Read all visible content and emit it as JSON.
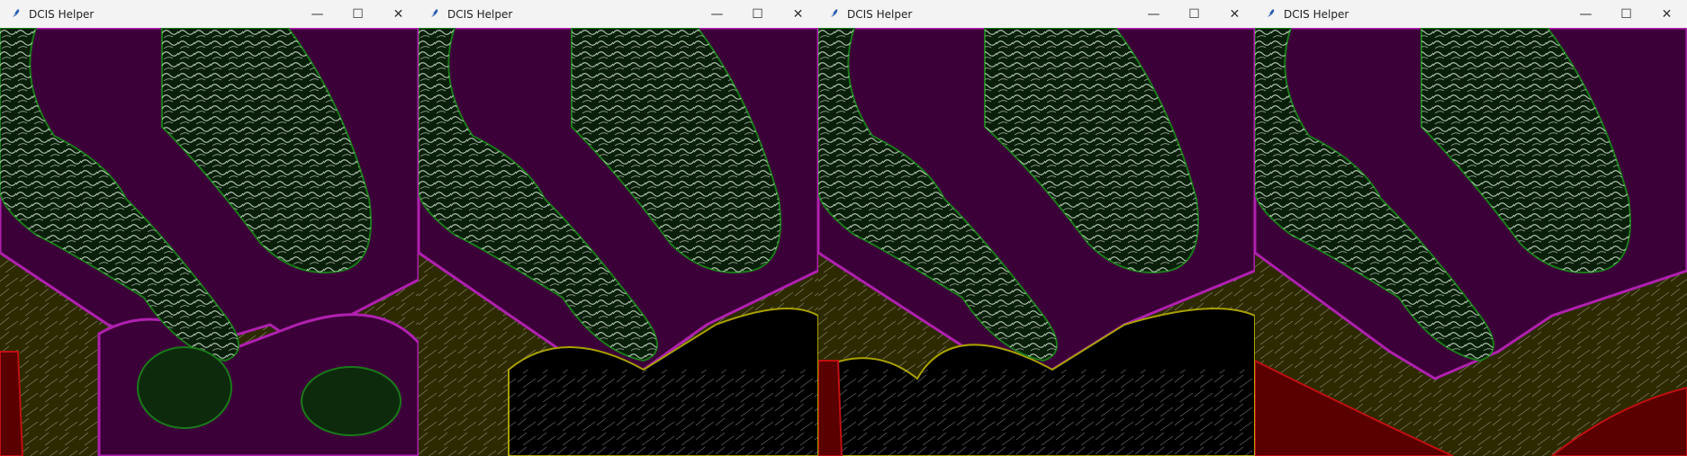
{
  "windows": [
    {
      "title": "DCIS Helper",
      "variant": 1
    },
    {
      "title": "DCIS Helper",
      "variant": 2
    },
    {
      "title": "DCIS Helper",
      "variant": 3
    },
    {
      "title": "DCIS Helper",
      "variant": 4
    }
  ],
  "controls": {
    "minimize": "—",
    "maximize": "☐",
    "close": "✕"
  },
  "icons": {
    "app": "feather-icon"
  },
  "colors": {
    "duct_region": "#0a1f0a",
    "periductal_region": "#3c0038",
    "periductal_outline": "#b020b0",
    "stroma_region": "#2d2a00",
    "stroma_outline": "#a8a000",
    "tumor_region": "#5a0000",
    "tumor_outline": "#c01010",
    "nucleus_outline": "#1a7a1a"
  }
}
